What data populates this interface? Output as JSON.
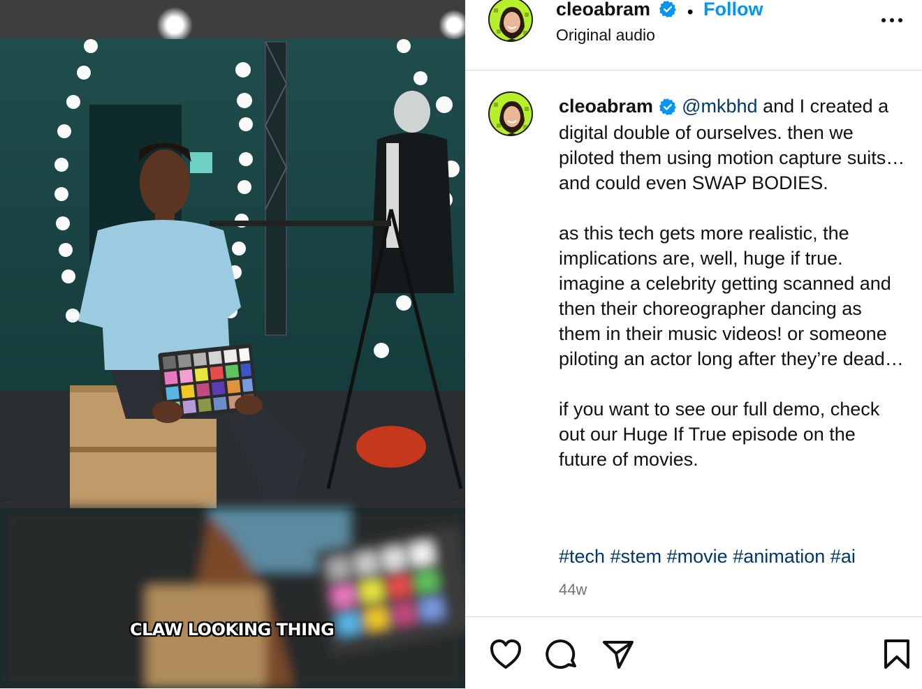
{
  "video": {
    "caption": "CLAW LOOKING THING"
  },
  "header": {
    "username": "cleoabram",
    "verified_icon": "verified-badge-icon",
    "separator": "•",
    "follow_label": "Follow",
    "audio_label": "Original audio",
    "more_icon": "more-options-icon"
  },
  "post": {
    "username": "cleoabram",
    "mention": "@mkbhd",
    "text_after_mention": " and I created a digital double of ourselves. then we piloted them using motion capture suits… and could even SWAP BODIES.\n\nas this tech gets more realistic, the implications are, well, huge if true. imagine a celebrity getting scanned and then their choreographer dancing as them in their music videos! or someone piloting an actor long after they’re dead…\n\nif you want to see our full demo, check out our Huge If True episode on the future of movies.",
    "hashtags": [
      "#tech",
      "#stem",
      "#movie",
      "#animation",
      "#ai"
    ],
    "time": "44w"
  },
  "actions": {
    "like_icon": "heart-icon",
    "comment_icon": "comment-icon",
    "share_icon": "share-icon",
    "save_icon": "bookmark-icon"
  },
  "colors": {
    "link": "#0095f6",
    "mention": "#00376b",
    "muted": "#737373",
    "avatar_bg": "#b7ef2b"
  }
}
